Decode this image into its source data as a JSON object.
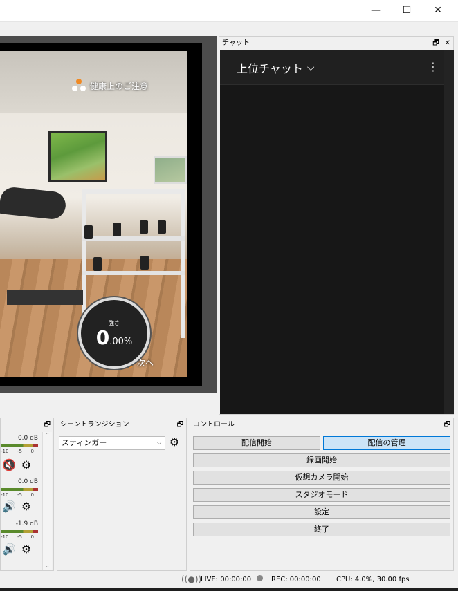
{
  "window": {
    "minimize_glyph": "—",
    "maximize_glyph": "☐",
    "close_glyph": "✕"
  },
  "preview": {
    "notice_label": "健康上のご注意",
    "next_label": "次へ",
    "gauge_label": "強さ",
    "gauge_value_main": "0",
    "gauge_value_decimal": ".00%"
  },
  "chat_dock": {
    "title": "チャット",
    "header": "上位チャット",
    "chevron": "⌵",
    "kebab": "⋮"
  },
  "mixer": {
    "channels": [
      {
        "db": "0.0 dB",
        "muted": true
      },
      {
        "db": "0.0 dB",
        "muted": false
      },
      {
        "db": "-1.9 dB",
        "muted": false
      }
    ],
    "scale": [
      "-10",
      "-5",
      "0"
    ]
  },
  "transitions": {
    "title": "シーントランジション",
    "selected": "スティンガー"
  },
  "controls": {
    "title": "コントロール",
    "start_stream": "配信開始",
    "manage_stream": "配信の管理",
    "start_record": "録画開始",
    "start_virtual_cam": "仮想カメラ開始",
    "studio_mode": "スタジオモード",
    "settings": "設定",
    "exit": "終了"
  },
  "status": {
    "live": "LIVE: 00:00:00",
    "rec": "REC: 00:00:00",
    "cpu": "CPU: 4.0%, 30.00 fps"
  },
  "colors": {
    "accent": "#0078d7",
    "active_button": "#cce4f7",
    "chat_bg": "#171717"
  }
}
